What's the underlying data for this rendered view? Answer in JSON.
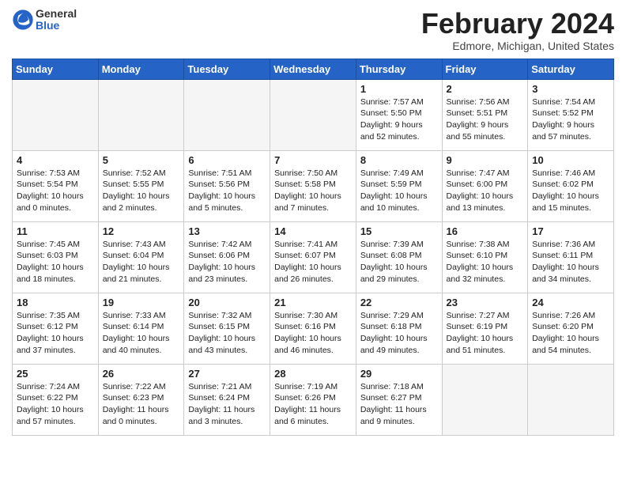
{
  "header": {
    "logo_general": "General",
    "logo_blue": "Blue",
    "month_year": "February 2024",
    "location": "Edmore, Michigan, United States"
  },
  "weekdays": [
    "Sunday",
    "Monday",
    "Tuesday",
    "Wednesday",
    "Thursday",
    "Friday",
    "Saturday"
  ],
  "weeks": [
    [
      {
        "day": "",
        "info": ""
      },
      {
        "day": "",
        "info": ""
      },
      {
        "day": "",
        "info": ""
      },
      {
        "day": "",
        "info": ""
      },
      {
        "day": "1",
        "info": "Sunrise: 7:57 AM\nSunset: 5:50 PM\nDaylight: 9 hours\nand 52 minutes."
      },
      {
        "day": "2",
        "info": "Sunrise: 7:56 AM\nSunset: 5:51 PM\nDaylight: 9 hours\nand 55 minutes."
      },
      {
        "day": "3",
        "info": "Sunrise: 7:54 AM\nSunset: 5:52 PM\nDaylight: 9 hours\nand 57 minutes."
      }
    ],
    [
      {
        "day": "4",
        "info": "Sunrise: 7:53 AM\nSunset: 5:54 PM\nDaylight: 10 hours\nand 0 minutes."
      },
      {
        "day": "5",
        "info": "Sunrise: 7:52 AM\nSunset: 5:55 PM\nDaylight: 10 hours\nand 2 minutes."
      },
      {
        "day": "6",
        "info": "Sunrise: 7:51 AM\nSunset: 5:56 PM\nDaylight: 10 hours\nand 5 minutes."
      },
      {
        "day": "7",
        "info": "Sunrise: 7:50 AM\nSunset: 5:58 PM\nDaylight: 10 hours\nand 7 minutes."
      },
      {
        "day": "8",
        "info": "Sunrise: 7:49 AM\nSunset: 5:59 PM\nDaylight: 10 hours\nand 10 minutes."
      },
      {
        "day": "9",
        "info": "Sunrise: 7:47 AM\nSunset: 6:00 PM\nDaylight: 10 hours\nand 13 minutes."
      },
      {
        "day": "10",
        "info": "Sunrise: 7:46 AM\nSunset: 6:02 PM\nDaylight: 10 hours\nand 15 minutes."
      }
    ],
    [
      {
        "day": "11",
        "info": "Sunrise: 7:45 AM\nSunset: 6:03 PM\nDaylight: 10 hours\nand 18 minutes."
      },
      {
        "day": "12",
        "info": "Sunrise: 7:43 AM\nSunset: 6:04 PM\nDaylight: 10 hours\nand 21 minutes."
      },
      {
        "day": "13",
        "info": "Sunrise: 7:42 AM\nSunset: 6:06 PM\nDaylight: 10 hours\nand 23 minutes."
      },
      {
        "day": "14",
        "info": "Sunrise: 7:41 AM\nSunset: 6:07 PM\nDaylight: 10 hours\nand 26 minutes."
      },
      {
        "day": "15",
        "info": "Sunrise: 7:39 AM\nSunset: 6:08 PM\nDaylight: 10 hours\nand 29 minutes."
      },
      {
        "day": "16",
        "info": "Sunrise: 7:38 AM\nSunset: 6:10 PM\nDaylight: 10 hours\nand 32 minutes."
      },
      {
        "day": "17",
        "info": "Sunrise: 7:36 AM\nSunset: 6:11 PM\nDaylight: 10 hours\nand 34 minutes."
      }
    ],
    [
      {
        "day": "18",
        "info": "Sunrise: 7:35 AM\nSunset: 6:12 PM\nDaylight: 10 hours\nand 37 minutes."
      },
      {
        "day": "19",
        "info": "Sunrise: 7:33 AM\nSunset: 6:14 PM\nDaylight: 10 hours\nand 40 minutes."
      },
      {
        "day": "20",
        "info": "Sunrise: 7:32 AM\nSunset: 6:15 PM\nDaylight: 10 hours\nand 43 minutes."
      },
      {
        "day": "21",
        "info": "Sunrise: 7:30 AM\nSunset: 6:16 PM\nDaylight: 10 hours\nand 46 minutes."
      },
      {
        "day": "22",
        "info": "Sunrise: 7:29 AM\nSunset: 6:18 PM\nDaylight: 10 hours\nand 49 minutes."
      },
      {
        "day": "23",
        "info": "Sunrise: 7:27 AM\nSunset: 6:19 PM\nDaylight: 10 hours\nand 51 minutes."
      },
      {
        "day": "24",
        "info": "Sunrise: 7:26 AM\nSunset: 6:20 PM\nDaylight: 10 hours\nand 54 minutes."
      }
    ],
    [
      {
        "day": "25",
        "info": "Sunrise: 7:24 AM\nSunset: 6:22 PM\nDaylight: 10 hours\nand 57 minutes."
      },
      {
        "day": "26",
        "info": "Sunrise: 7:22 AM\nSunset: 6:23 PM\nDaylight: 11 hours\nand 0 minutes."
      },
      {
        "day": "27",
        "info": "Sunrise: 7:21 AM\nSunset: 6:24 PM\nDaylight: 11 hours\nand 3 minutes."
      },
      {
        "day": "28",
        "info": "Sunrise: 7:19 AM\nSunset: 6:26 PM\nDaylight: 11 hours\nand 6 minutes."
      },
      {
        "day": "29",
        "info": "Sunrise: 7:18 AM\nSunset: 6:27 PM\nDaylight: 11 hours\nand 9 minutes."
      },
      {
        "day": "",
        "info": ""
      },
      {
        "day": "",
        "info": ""
      }
    ]
  ]
}
